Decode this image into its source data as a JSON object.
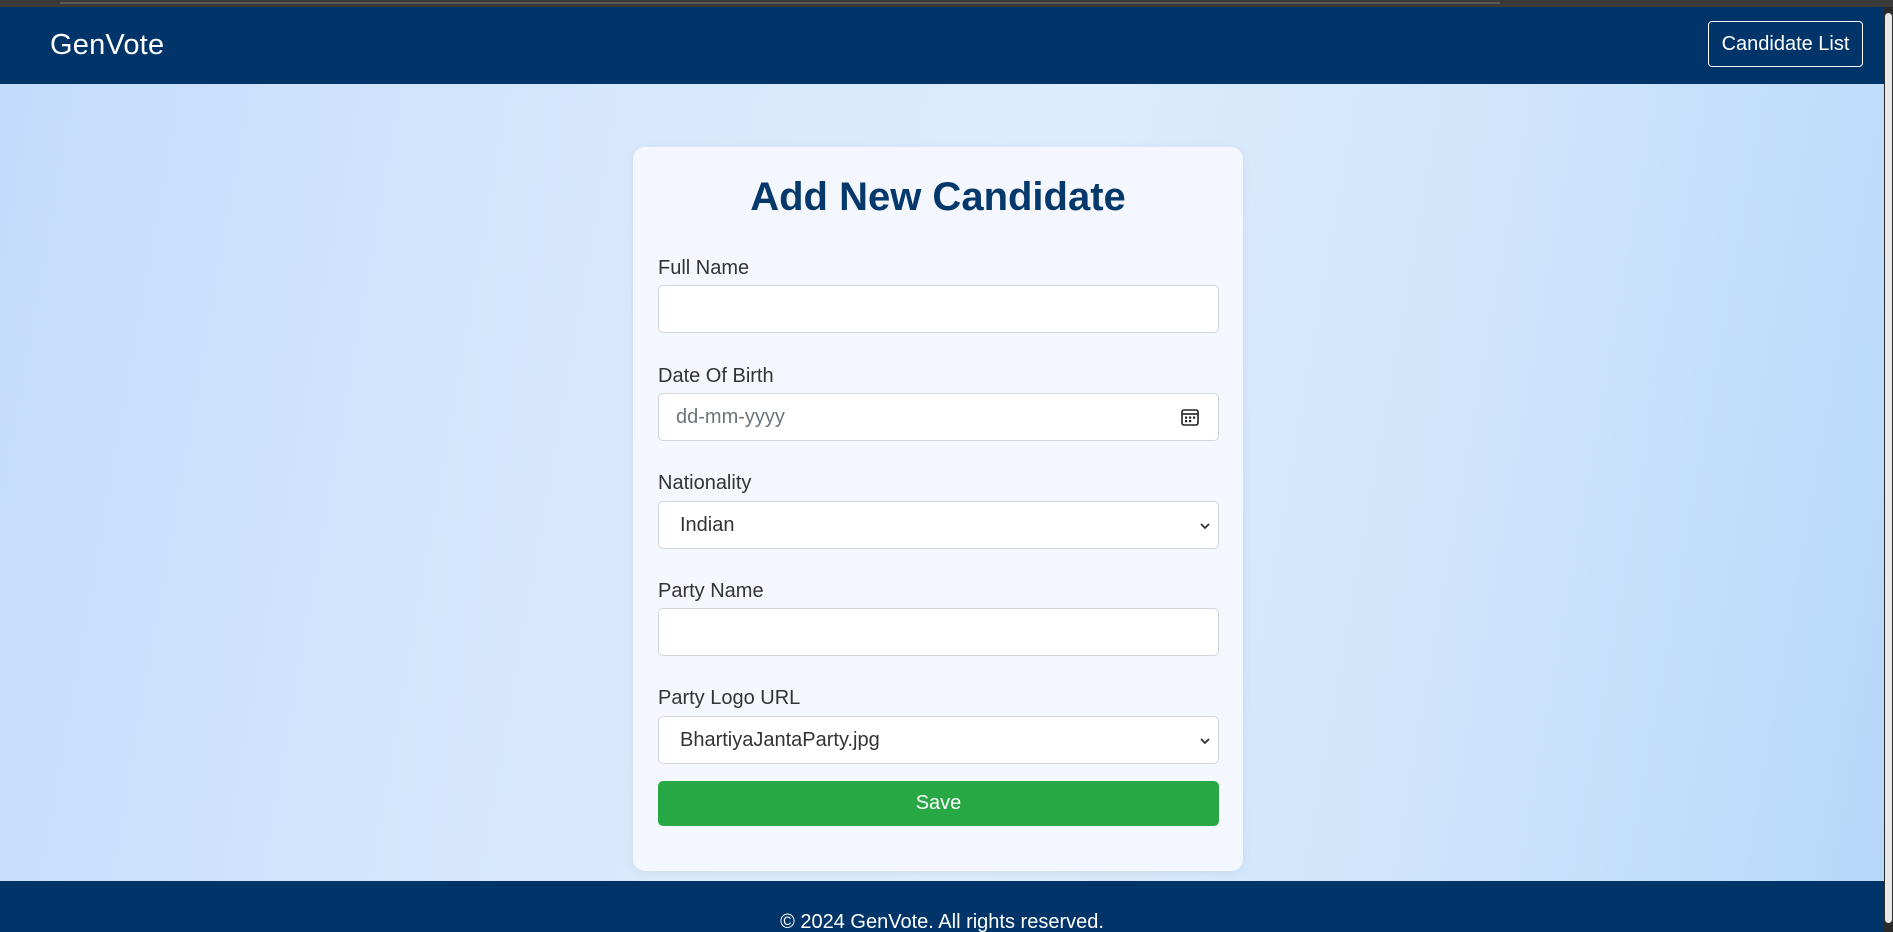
{
  "navbar": {
    "brand": "GenVote",
    "candidate_list_label": "Candidate List"
  },
  "form": {
    "title": "Add New Candidate",
    "full_name": {
      "label": "Full Name",
      "value": ""
    },
    "dob": {
      "label": "Date Of Birth",
      "placeholder": "dd-mm-yyyy"
    },
    "nationality": {
      "label": "Nationality",
      "selected": "Indian"
    },
    "party_name": {
      "label": "Party Name",
      "value": ""
    },
    "party_logo": {
      "label": "Party Logo URL",
      "selected": "BhartiyaJantaParty.jpg"
    },
    "save_label": "Save"
  },
  "footer": {
    "text": "© 2024 GenVote. All rights reserved."
  },
  "icons": {
    "calendar": "calendar-icon",
    "dropdown": "chevron-down-icon"
  },
  "colors": {
    "navbar": "#01356a",
    "title": "#05386b",
    "save_button": "#28a745"
  }
}
